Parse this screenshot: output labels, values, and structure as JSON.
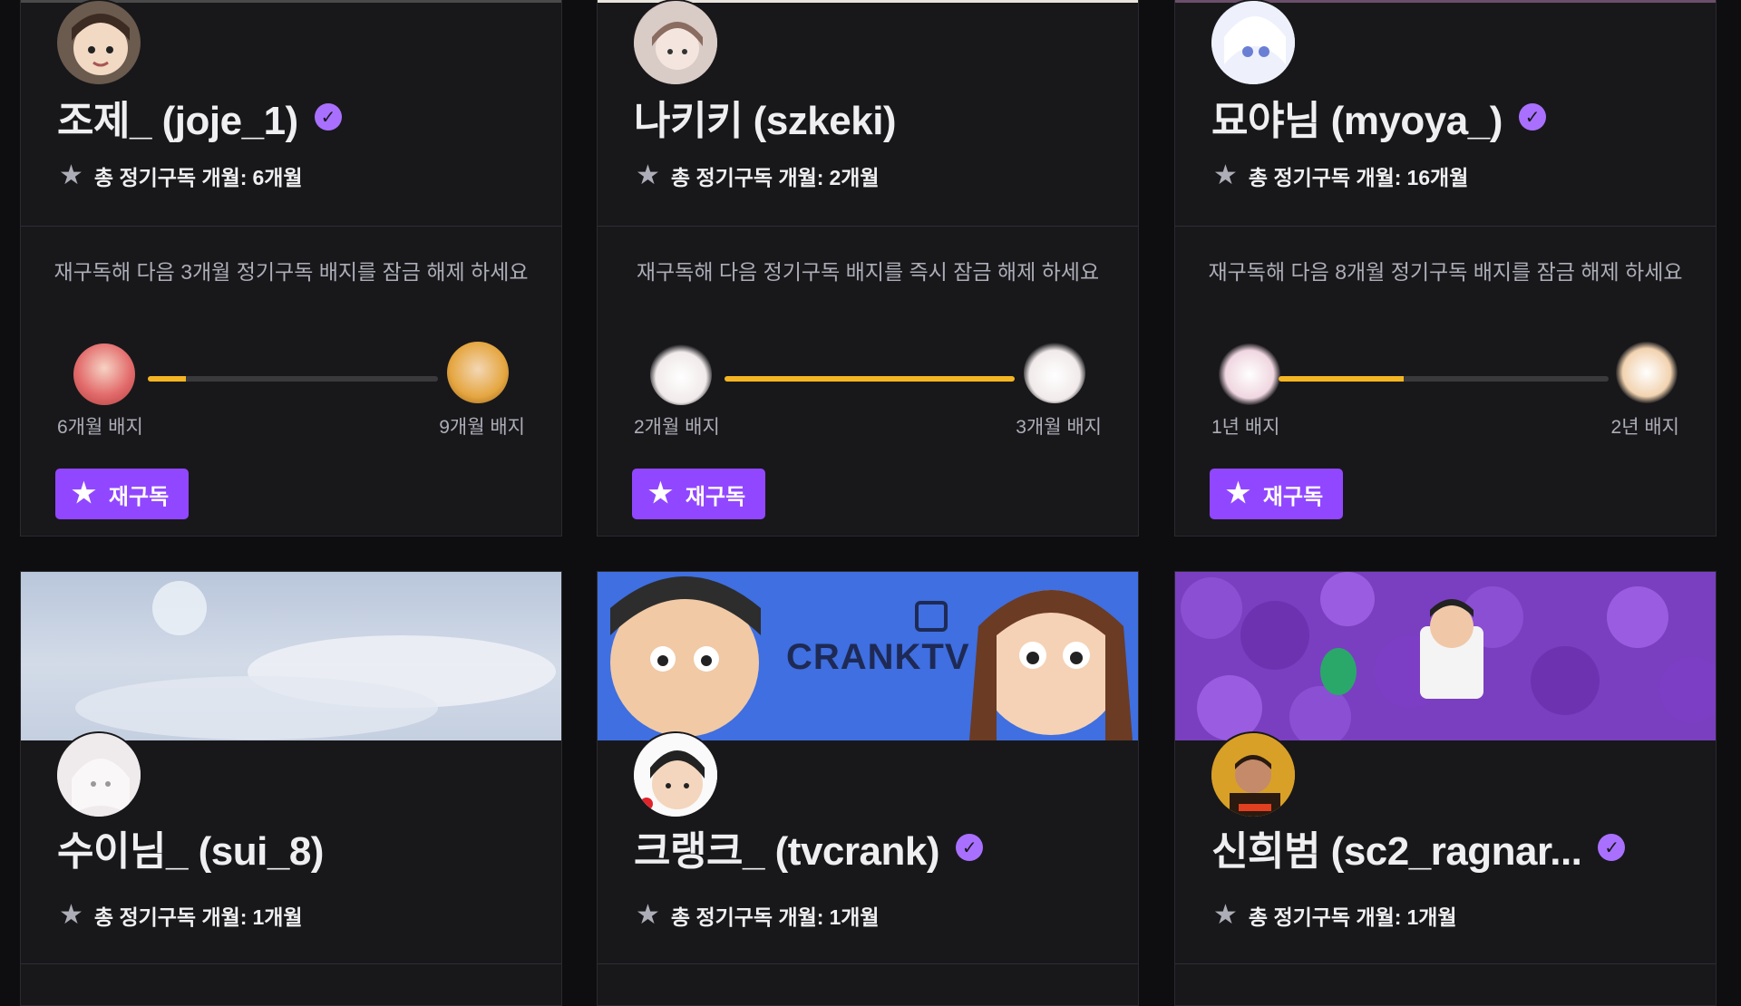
{
  "cards": [
    {
      "name": "조제_ (joje_1)",
      "verified": true,
      "subs_label": "총 정기구독 개월:",
      "subs_value": "6개월",
      "unlock_text": "재구독해 다음 3개월 정기구독 배지를 잠금 해제 하세요",
      "progress": 0.13,
      "badge_from": "6개월 배지",
      "badge_to": "9개월 배지",
      "button_label": "재구독",
      "colors": {
        "strip": "#4a4a4a",
        "avatar": "#6b5a4e"
      }
    },
    {
      "name": "나키키 (szkeki)",
      "verified": false,
      "subs_label": "총 정기구독 개월:",
      "subs_value": "2개월",
      "unlock_text": "재구독해 다음 정기구독 배지를 즉시 잠금 해제 하세요",
      "progress": 1.0,
      "badge_from": "2개월 배지",
      "badge_to": "3개월 배지",
      "button_label": "재구독",
      "colors": {
        "strip": "#e9e4dc",
        "avatar": "#c9b8b2"
      }
    },
    {
      "name": "묘야님 (myoya_)",
      "verified": true,
      "subs_label": "총 정기구독 개월:",
      "subs_value": "16개월",
      "unlock_text": "재구독해 다음 8개월 정기구독 배지를 잠금 해제 하세요",
      "progress": 0.38,
      "badge_from": "1년 배지",
      "badge_to": "2년 배지",
      "button_label": "재구독",
      "colors": {
        "strip": "#6b4f6a",
        "avatar": "#dfe5f5"
      }
    },
    {
      "name": "수이님_ (sui_8)",
      "verified": false,
      "subs_label": "총 정기구독 개월:",
      "subs_value": "1개월",
      "colors": {
        "banner": "#c9d3e4",
        "avatar": "#e6e2e4"
      }
    },
    {
      "name": "크랭크_ (tvcrank)",
      "verified": true,
      "subs_label": "총 정기구독 개월:",
      "subs_value": "1개월",
      "banner_text": "CRANKTV",
      "colors": {
        "banner": "#3f6fe0",
        "avatar": "#f2f2f2"
      }
    },
    {
      "name": "신희범 (sc2_ragnar...",
      "verified": true,
      "subs_label": "총 정기구독 개월:",
      "subs_value": "1개월",
      "colors": {
        "banner": "#7a3fc0",
        "avatar": "#d49a20"
      }
    }
  ],
  "icons": {
    "star": "star-icon",
    "verified": "verified-check-icon"
  }
}
